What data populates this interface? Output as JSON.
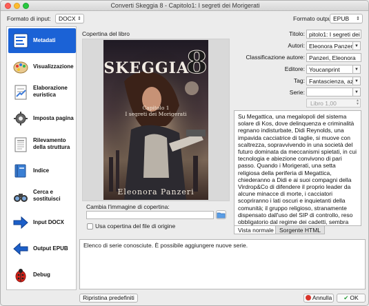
{
  "window": {
    "title": "Converti Skeggia 8 - Capitolo1: I segreti dei Morigerati"
  },
  "format": {
    "input_label": "Formato di input:",
    "input_value": "DOCX",
    "output_label": "Formato output",
    "output_value": "EPUB"
  },
  "sidebar": {
    "items": [
      {
        "label": "Metadati",
        "icon": "metadata-icon"
      },
      {
        "label": "Visualizzazione",
        "icon": "palette-icon"
      },
      {
        "label": "Elaborazione euristica",
        "icon": "heuristics-icon"
      },
      {
        "label": "Imposta pagina",
        "icon": "page-setup-icon"
      },
      {
        "label": "Rilevamento della struttura",
        "icon": "structure-icon"
      },
      {
        "label": "Indice",
        "icon": "index-book-icon"
      },
      {
        "label": "Cerca e sostituisci",
        "icon": "binoculars-icon"
      },
      {
        "label": "Input DOCX",
        "icon": "arrow-right-icon"
      },
      {
        "label": "Output EPUB",
        "icon": "arrow-left-icon"
      },
      {
        "label": "Debug",
        "icon": "ladybug-icon"
      }
    ]
  },
  "cover": {
    "section_title": "Copertina del libro",
    "book_title_art": "SKEGGIA",
    "book_number_art": "8",
    "book_subtitle_line1": "Capitolo 1",
    "book_subtitle_line2": "I segreti dei Morigerati",
    "book_author_art": "Eleonora Panzeri",
    "change_label": "Cambia l'immagine di copertina:",
    "path_value": "",
    "use_source_cover_label": "Usa copertina del file di origine"
  },
  "fields": {
    "title_label": "Titolo:",
    "title_value": "pitolo1: I segreti dei Morigerati",
    "authors_label": "Autori:",
    "authors_value": "Eleonora Panzeri",
    "author_sort_label": "Classificazione autore:",
    "author_sort_value": "Panzeri, Eleonora",
    "publisher_label": "Editore:",
    "publisher_value": "Youcanprint",
    "tags_label": "Tag:",
    "tags_value": "Fantascienza, azione, miste",
    "series_label": "Serie:",
    "series_value": "",
    "series_index": "Libro 1,00"
  },
  "description": {
    "text": "Su Megattica, una megalopoli del sistema solare di Kos, dove delinquenza e criminalità regnano indisturbate, Didi Reynolds, una impavida cacciatrice di taglie, si muove con scaltrezza, sopravvivendo in una società del futuro dominata da meccanismi spietati, in cui tecnologia e abiezione convivono di pari passo. Quando i Morigerati, una setta religiosa della periferia di Megattica, chiederanno a Didi e ai suoi compagni della Virdrop&Co di difendere il proprio leader da alcune minacce di morte, i cacciatori scopriranno i lati oscuri e inquietanti della comunità; il gruppo religioso, stranamente dispensato dall'uso del SIP di controllo, reso obbligatorio dal regime dei cadetti, sembra nascondere segreti e sinistre verità.",
    "tab_normal": "Vista normale",
    "tab_html": "Sorgente HTML"
  },
  "status": {
    "text": "Elenco di serie conosciute. È possibile aggiungere nuove serie."
  },
  "buttons": {
    "reset_label": "Ripristina predefiniti",
    "cancel_label": "Annulla",
    "ok_label": "OK"
  }
}
